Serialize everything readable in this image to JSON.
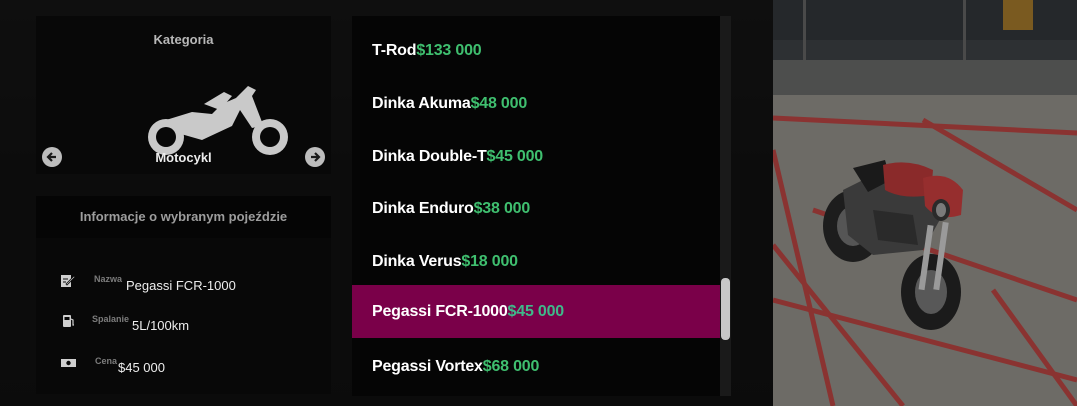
{
  "category": {
    "title": "Kategoria",
    "name": "Motocykl",
    "icon": "motorcycle-icon"
  },
  "info": {
    "title": "Informacje o wybranym pojeździe",
    "rows": [
      {
        "icon": "edit-icon",
        "label": "Nazwa",
        "value": "Pegassi FCR-1000"
      },
      {
        "icon": "fuel-icon",
        "label": "Spalanie",
        "value": "5L/100km"
      },
      {
        "icon": "money-icon",
        "label": "Cena",
        "value": "$45 000"
      }
    ]
  },
  "vehicles": [
    {
      "name": "T-Rod",
      "price": "$133 000"
    },
    {
      "name": "Dinka Akuma",
      "price": "$48 000"
    },
    {
      "name": "Dinka Double-T",
      "price": "$45 000"
    },
    {
      "name": "Dinka Enduro",
      "price": "$38 000"
    },
    {
      "name": "Dinka Verus",
      "price": "$18 000"
    },
    {
      "name": "Pegassi FCR-1000",
      "price": "$45 000",
      "selected": true
    },
    {
      "name": "Pegassi Vortex",
      "price": "$68 000"
    }
  ],
  "colors": {
    "selected_bg": "#7a0049",
    "price_green": "#3fbf6f"
  }
}
